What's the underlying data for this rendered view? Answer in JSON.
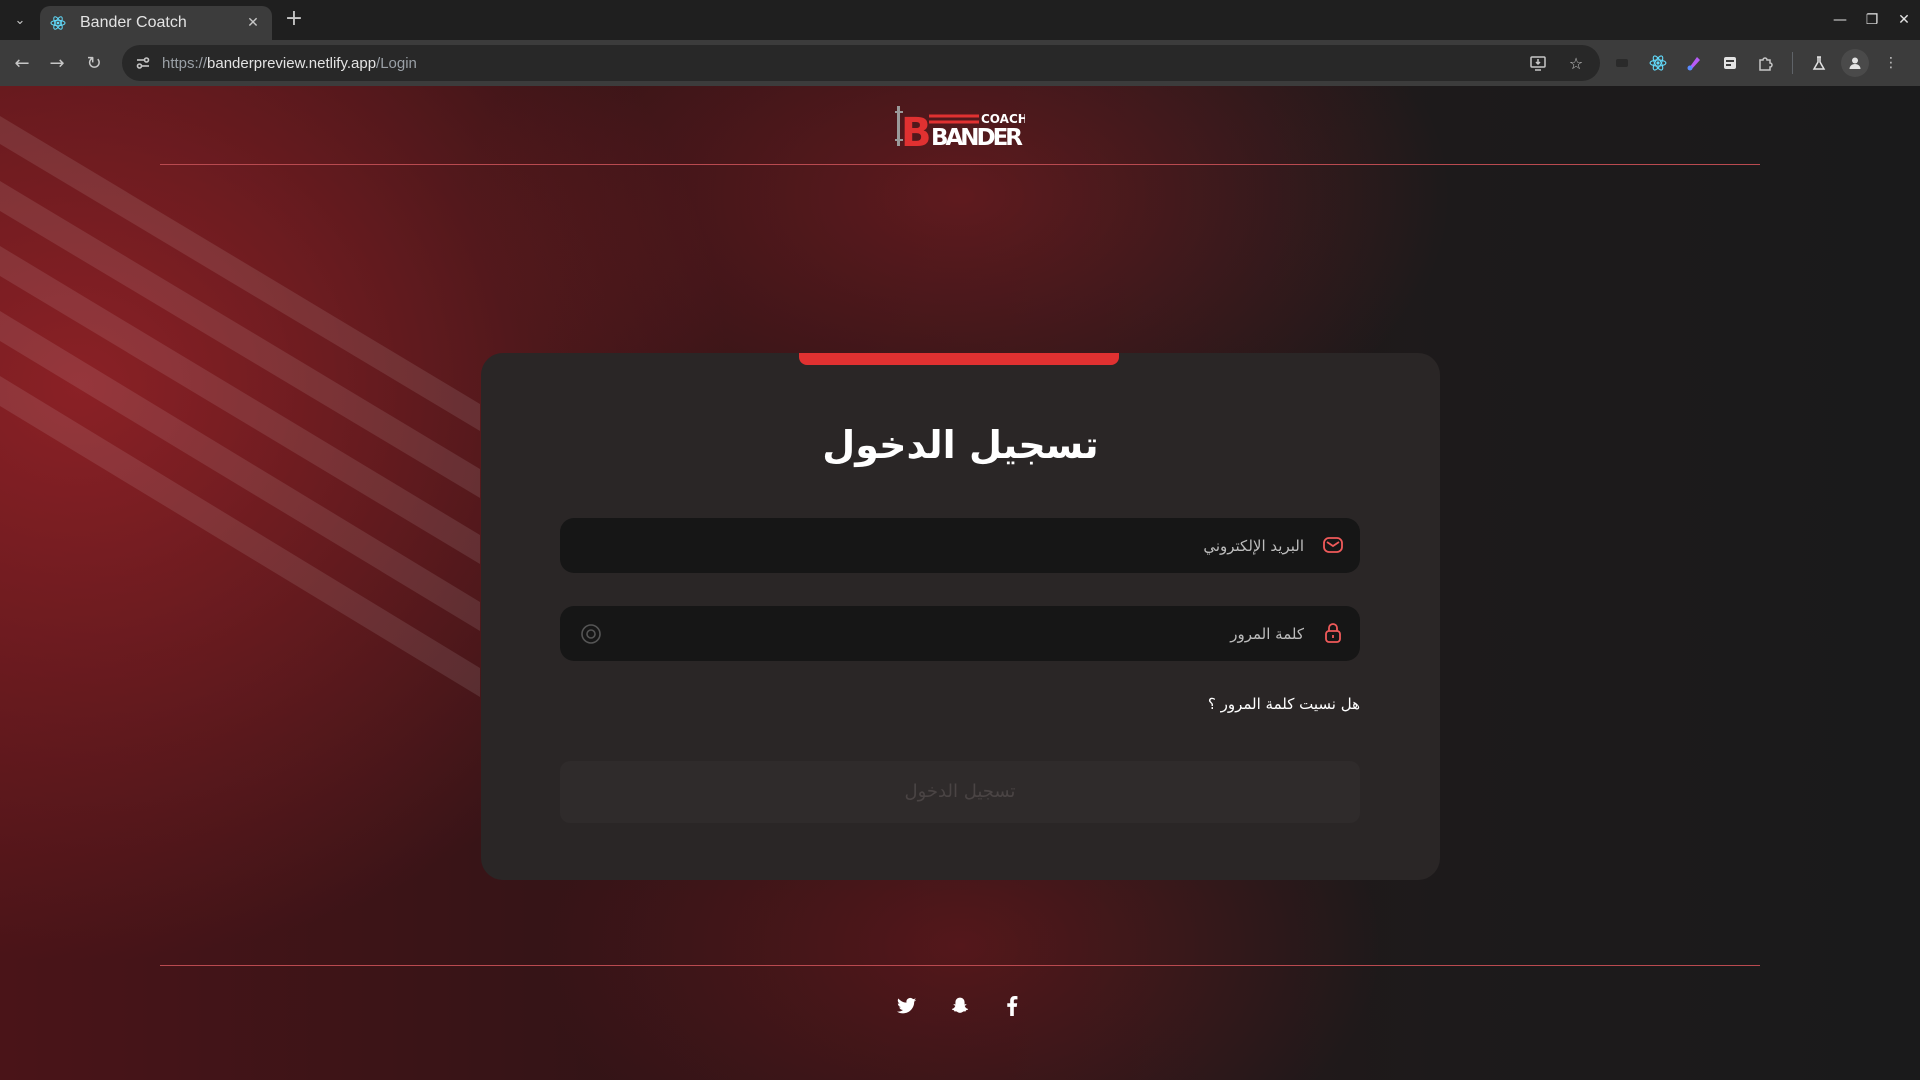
{
  "browser": {
    "tab_title": "Bander Coatch",
    "url_scheme": "https://",
    "url_host": "banderpreview.netlify.app",
    "url_path": "/Login"
  },
  "header": {
    "logo_word": "BANDER",
    "logo_tag": "COACH"
  },
  "login": {
    "title": "تسجيل الدخول",
    "email_placeholder": "البريد الإلكتروني",
    "password_placeholder": "كلمة المرور",
    "forgot_label": "هل نسيت كلمة المرور ؟",
    "submit_label": "تسجيل الدخول"
  },
  "footer": {
    "social": [
      "twitter-icon",
      "snapchat-icon",
      "facebook-icon"
    ]
  },
  "colors": {
    "accent": "#e03131",
    "card": "#2a2626",
    "field": "#161616",
    "divider": "#b94a50"
  }
}
